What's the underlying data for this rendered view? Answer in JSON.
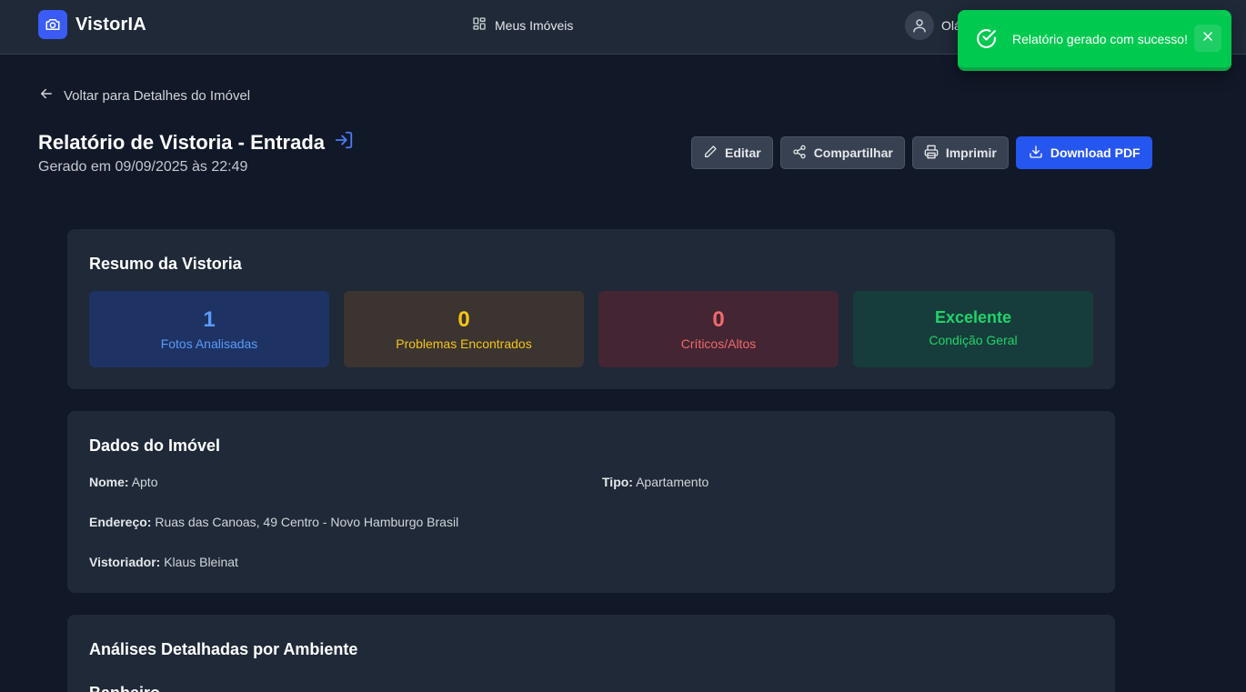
{
  "app": {
    "name": "VistorIA"
  },
  "nav": {
    "meus_imoveis": "Meus Imóveis"
  },
  "user": {
    "greeting": "Olá"
  },
  "toast": {
    "message": "Relatório gerado com sucesso!"
  },
  "back": {
    "label": "Voltar para Detalhes do Imóvel"
  },
  "header": {
    "title": "Relatório de Vistoria - Entrada",
    "subtitle": "Gerado em 09/09/2025 às 22:49"
  },
  "actions": {
    "edit": "Editar",
    "share": "Compartilhar",
    "print": "Imprimir",
    "download": "Download PDF"
  },
  "summary": {
    "title": "Resumo da Vistoria",
    "stats": [
      {
        "value": "1",
        "label": "Fotos Analisadas"
      },
      {
        "value": "0",
        "label": "Problemas Encontrados"
      },
      {
        "value": "0",
        "label": "Críticos/Altos"
      },
      {
        "value": "Excelente",
        "label": "Condição Geral"
      }
    ]
  },
  "property": {
    "title": "Dados do Imóvel",
    "nome_label": "Nome:",
    "nome": "Apto",
    "tipo_label": "Tipo:",
    "tipo": "Apartamento",
    "endereco_label": "Endereço:",
    "endereco": "Ruas das Canoas, 49 Centro - Novo Hamburgo Brasil",
    "vistoriador_label": "Vistoriador:",
    "vistoriador": "Klaus Bleinat"
  },
  "analyses": {
    "title": "Análises Detalhadas por Ambiente",
    "first_room": "Banheiro"
  },
  "colors": {
    "accent": "#2656f0",
    "success": "#00c950",
    "background": "#111827",
    "card": "#1f2937"
  }
}
